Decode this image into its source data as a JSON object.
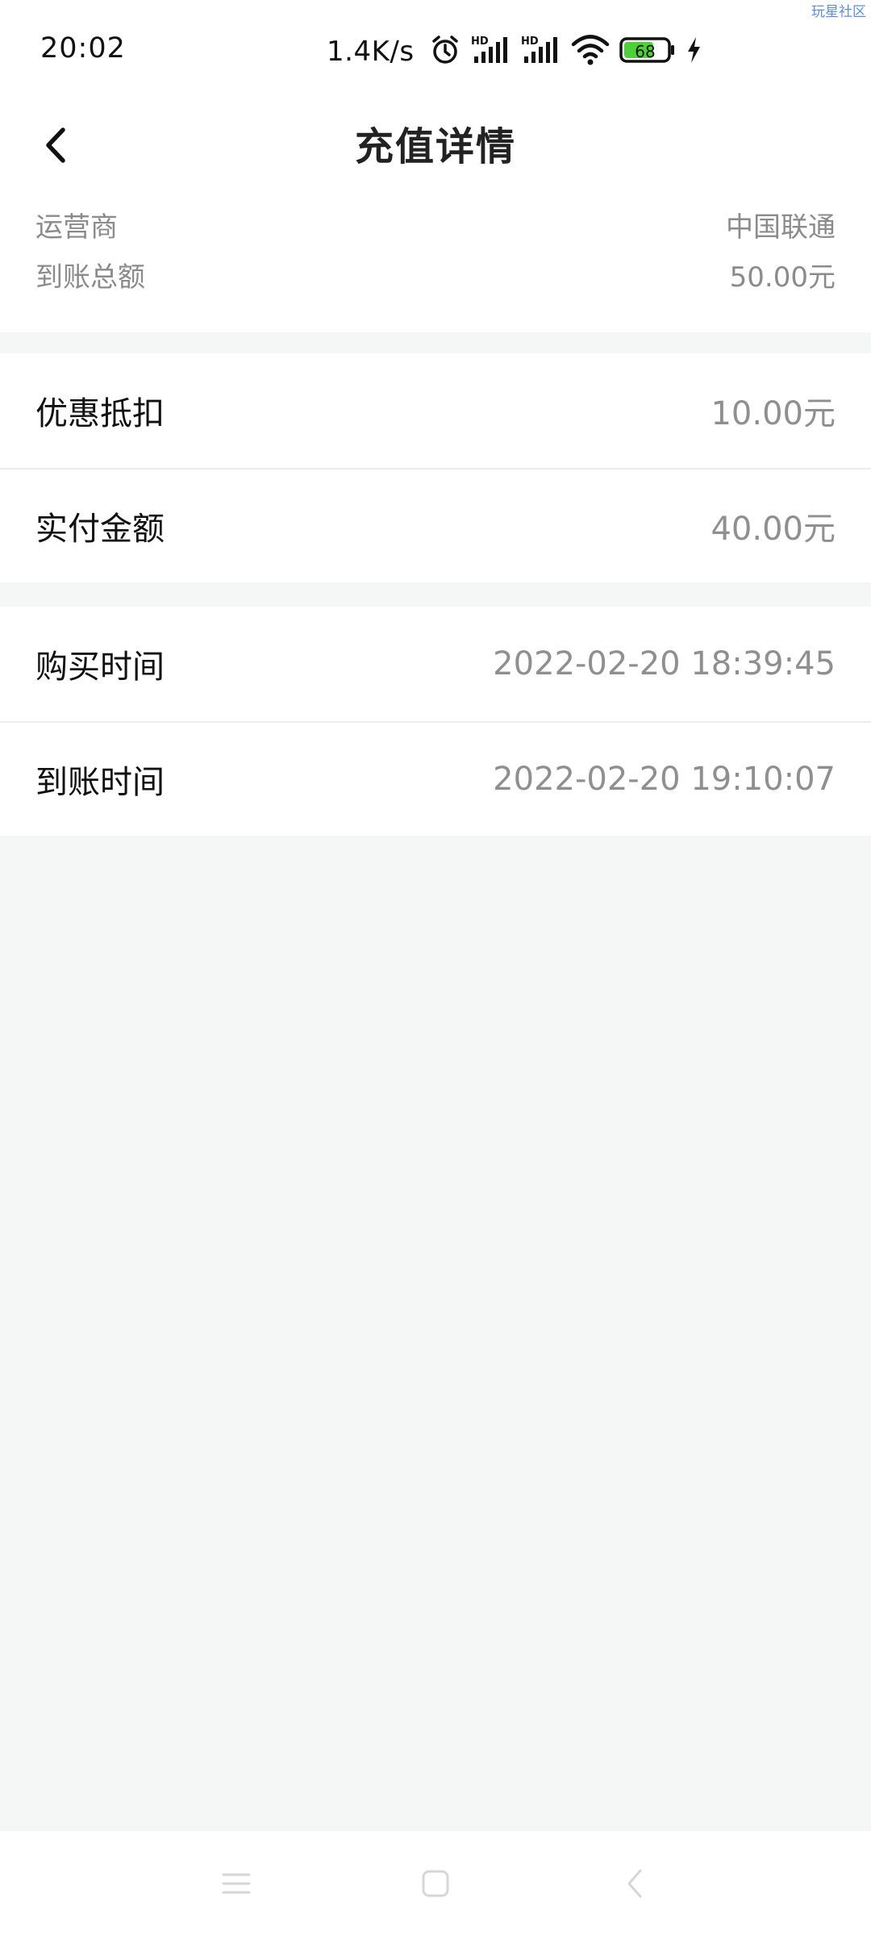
{
  "status_bar": {
    "time": "20:02",
    "network_speed": "1.4K/s",
    "hd_label": "HD",
    "battery_level": "68",
    "icons": [
      "alarm-icon",
      "signal-hd-icon",
      "signal-hd-icon",
      "wifi-icon",
      "battery-icon",
      "charging-icon"
    ]
  },
  "watermark": "玩星社区",
  "header": {
    "title": "充值详情",
    "back_icon": "chevron-left-icon"
  },
  "summary": {
    "operator_label": "运营商",
    "operator_value": "中国联通",
    "total_label": "到账总额",
    "total_value": "50.00元"
  },
  "amounts": {
    "discount_label": "优惠抵扣",
    "discount_value": "10.00元",
    "paid_label": "实付金额",
    "paid_value": "40.00元"
  },
  "times": {
    "purchase_label": "购买时间",
    "purchase_value": "2022-02-20 18:39:45",
    "arrival_label": "到账时间",
    "arrival_value": "2022-02-20 19:10:07"
  },
  "nav_bar": {
    "icons": [
      "menu-icon",
      "home-icon",
      "back-icon"
    ]
  },
  "colors": {
    "background": "#f5f6f6",
    "surface": "#ffffff",
    "text_primary": "#111111",
    "text_secondary": "#8f8f8f",
    "battery_fill": "#4cd137"
  }
}
